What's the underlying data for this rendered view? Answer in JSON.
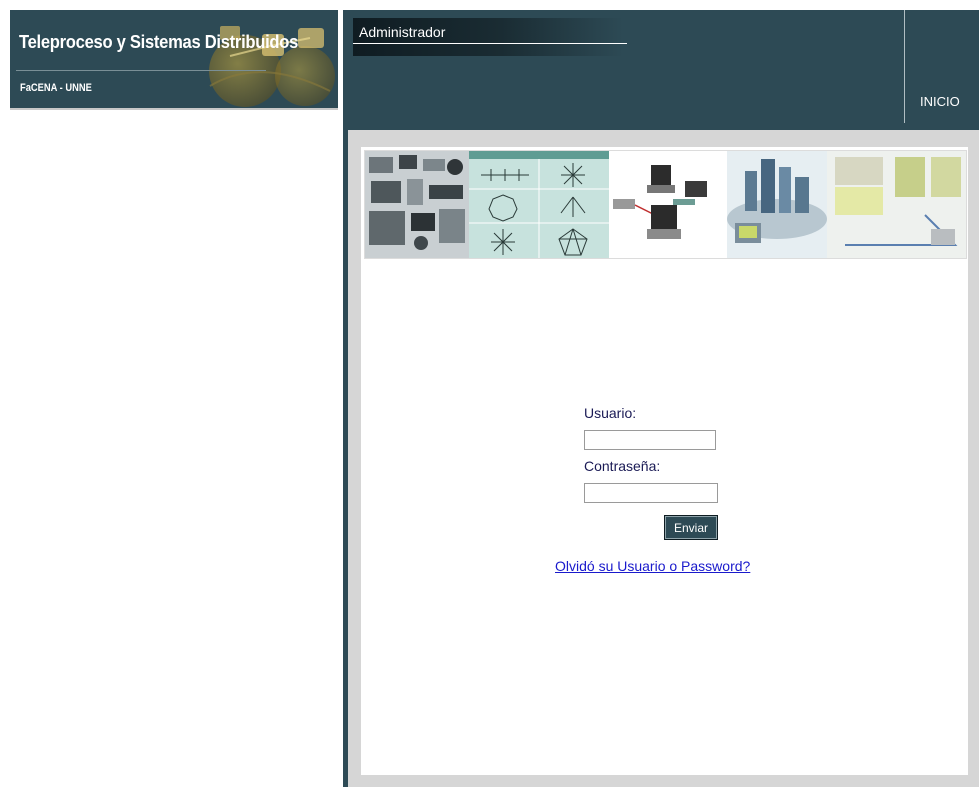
{
  "site": {
    "title": "Teleproceso y Sistemas Distribuidos",
    "subtitle": "FaCENA - UNNE"
  },
  "header": {
    "admin_label": "Administrador",
    "inicio_label": "INICIO"
  },
  "login": {
    "usuario_label": "Usuario:",
    "usuario_value": "",
    "password_label": "Contraseña:",
    "password_value": "",
    "submit_label": "Enviar",
    "forgot_link": "Olvidó su Usuario o Password?"
  },
  "banner": {
    "icons": [
      "devices-collage",
      "network-topologies-chart",
      "computer-network",
      "city-network",
      "building-network"
    ]
  },
  "colors": {
    "primary": "#2d4a55",
    "link": "#1a1acc",
    "frame": "#d6d6d6"
  }
}
